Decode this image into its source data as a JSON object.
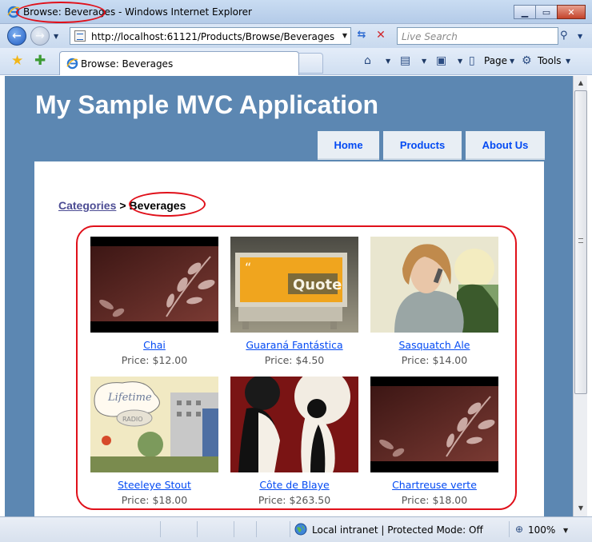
{
  "window": {
    "title_page": "Browse: Beverages",
    "title_app": "Windows Internet Explorer",
    "title_separator": " - "
  },
  "addressbar": {
    "url": "http://localhost:61121/Products/Browse/Beverages",
    "search_placeholder": "Live Search"
  },
  "tab": {
    "label": "Browse: Beverages"
  },
  "commandbar": {
    "page_label": "Page",
    "tools_label": "Tools"
  },
  "site": {
    "title": "My Sample MVC Application",
    "menu": [
      {
        "label": "Home"
      },
      {
        "label": "Products"
      },
      {
        "label": "About Us"
      }
    ]
  },
  "breadcrumb": {
    "link": "Categories",
    "separator": ">",
    "current": "Beverages"
  },
  "products": [
    {
      "name": "Chai",
      "price": "Price: $12.00",
      "image": "leaves-red"
    },
    {
      "name": "Guaraná Fantástica",
      "price": "Price: $4.50",
      "image": "quote-bench"
    },
    {
      "name": "Sasquatch Ale",
      "price": "Price: $14.00",
      "image": "woman-phone"
    },
    {
      "name": "Steeleye Stout",
      "price": "Price: $18.00",
      "image": "lifetime-radio"
    },
    {
      "name": "Côte de Blaye",
      "price": "Price: $263.50",
      "image": "silhouettes"
    },
    {
      "name": "Chartreuse verte",
      "price": "Price: $18.00",
      "image": "leaves-red"
    }
  ],
  "statusbar": {
    "zone": "Local intranet | Protected Mode: Off",
    "zoom": "100%"
  },
  "colors": {
    "accent": "#5c87b2",
    "link": "#034af3",
    "highlight": "#e0101a"
  }
}
